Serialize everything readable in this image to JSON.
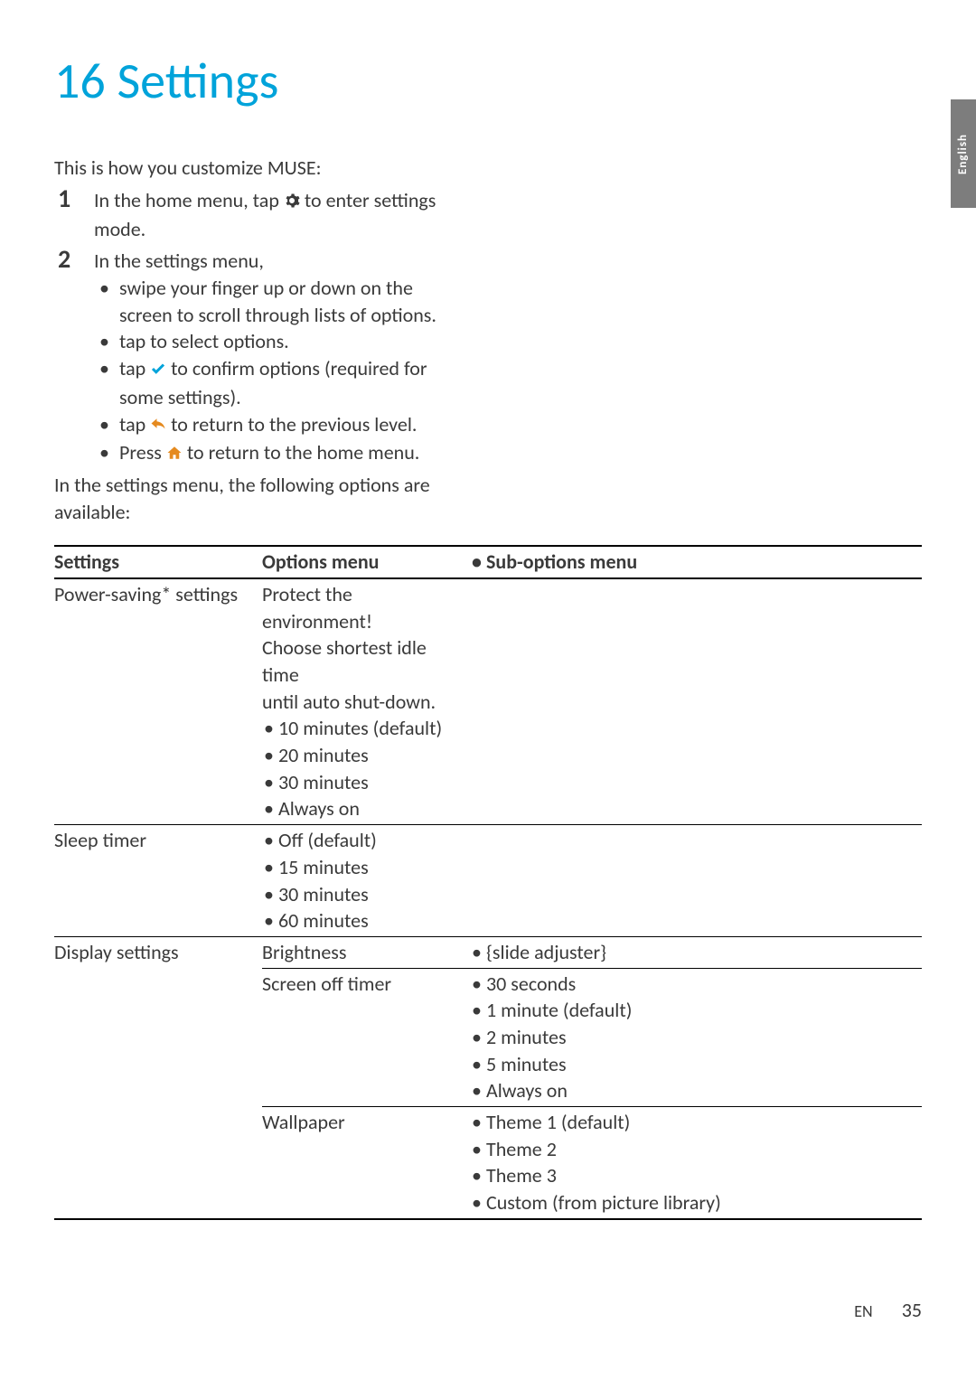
{
  "side_tab": "English",
  "chapter_num": "16",
  "chapter_title": "Settings",
  "intro": "This is how you customize MUSE:",
  "steps": [
    {
      "num": "1",
      "text_before_icon": "In the home menu, tap ",
      "icon": "gear-icon",
      "text_after_icon": " to enter settings mode."
    },
    {
      "num": "2",
      "text_lead": "In the settings menu,",
      "bullets": [
        {
          "text": "swipe your finger up or down on the screen to scroll through lists of options."
        },
        {
          "text": "tap to select options."
        },
        {
          "before": "tap ",
          "icon": "check-icon",
          "after": " to confirm options (required for some settings)."
        },
        {
          "before": "tap ",
          "icon": "back-icon",
          "after": " to return to the previous level."
        },
        {
          "before": "Press ",
          "icon": "home-icon",
          "after": " to return to the home menu."
        }
      ]
    }
  ],
  "after_steps": "In the settings menu, the following options are available:",
  "table": {
    "headers": {
      "settings": "Settings",
      "options": "Options menu",
      "sub": "Sub-options menu"
    },
    "rows": [
      {
        "setting": "Power-saving* settings",
        "options_lead": [
          "Protect the environment!",
          "Choose shortest idle time",
          "until auto shut-down."
        ],
        "options_bullets": [
          "10 minutes (default)",
          "20 minutes",
          "30 minutes",
          "Always on"
        ],
        "sub_bullets": []
      },
      {
        "setting": "Sleep timer",
        "options_bullets": [
          "Off (default)",
          "15 minutes",
          "30 minutes",
          "60 minutes"
        ],
        "sub_bullets": []
      },
      {
        "setting": "Display settings",
        "sub_rows": [
          {
            "option": "Brightness",
            "sub": [
              "{slide adjuster}"
            ]
          },
          {
            "option": "Screen off timer",
            "sub": [
              "30 seconds",
              "1 minute (default)",
              "2 minutes",
              "5 minutes",
              "Always on"
            ]
          },
          {
            "option": "Wallpaper",
            "sub": [
              "Theme 1 (default)",
              "Theme 2",
              "Theme 3",
              "Custom (from picture library)"
            ]
          }
        ]
      }
    ]
  },
  "footer": {
    "lang": "EN",
    "page": "35"
  }
}
